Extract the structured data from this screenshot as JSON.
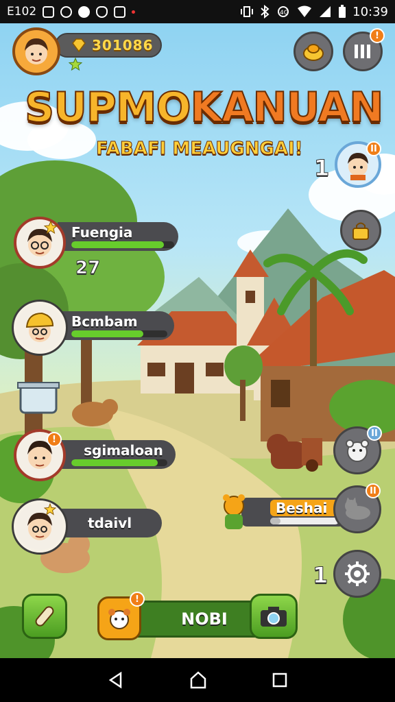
{
  "status_bar": {
    "left_text": "E102",
    "time": "10:39",
    "icons": [
      "image-icon",
      "clock-icon",
      "location-icon",
      "shield-icon",
      "app-icon",
      "dot-icon"
    ],
    "right_icons": [
      "vibrate-icon",
      "bluetooth-icon",
      "data-icon",
      "wifi-icon",
      "signal-icon",
      "battery-icon"
    ]
  },
  "hud": {
    "coins": "301086",
    "player_avatar_icon": "player-avatar",
    "level_icon": "star-icon",
    "shop_button_icon": "coin-bag-icon",
    "menu_button_icon": "menu-icon",
    "menu_badge": "!"
  },
  "title": {
    "part1": "SUPMO",
    "part2": "KANUAN",
    "subtitle": "FABAFI MEAUGNGAI!"
  },
  "characters": [
    {
      "name": "Fuengia",
      "progress": 0.9,
      "count": "27",
      "has_star": true
    },
    {
      "name": "Bcmbam",
      "progress": 0.75
    },
    {
      "name": "sgimaloan",
      "progress": 0.9,
      "badge": "!"
    },
    {
      "name": "tdaivl",
      "has_star": true
    }
  ],
  "right_panel": {
    "top_count": "1",
    "top_badge": "II",
    "lock_icon": "lock-icon",
    "bear_badge": "II",
    "hire_label": "Beshai",
    "hire_progress": 0.15,
    "hire_badge": "II",
    "gear_count": "1"
  },
  "bottom": {
    "label": "NOBI",
    "left_icon": "scroll-icon",
    "pet_badge": "!",
    "right_icon": "camera-icon"
  },
  "nav": [
    "back-icon",
    "home-icon",
    "recents-icon"
  ]
}
